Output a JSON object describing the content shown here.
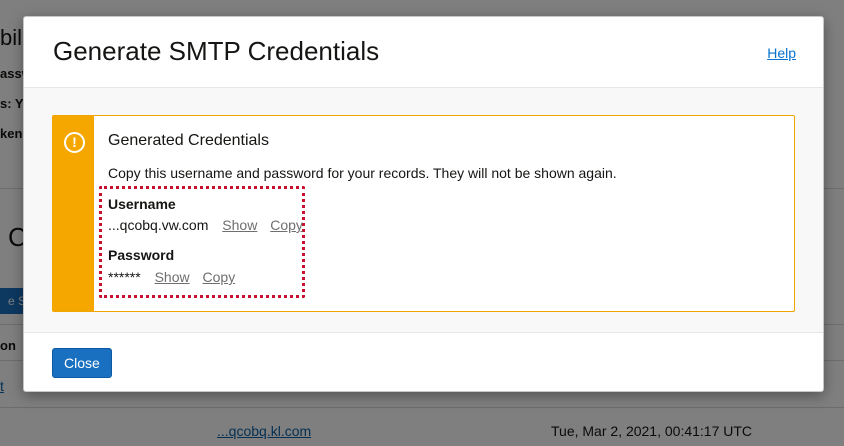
{
  "background": {
    "title_fragment": "bili",
    "label_1": "assw",
    "label_2": "s: Ye",
    "label_3": "kens",
    "section_heading": "C",
    "button_fragment": "e SM",
    "column_fragment": "on",
    "row_link_fragment": "t",
    "row_link": "...qcobq.kl.com",
    "row_timestamp": "Tue, Mar 2, 2021, 00:41:17 UTC"
  },
  "dialog": {
    "title": "Generate SMTP Credentials",
    "help_label": "Help",
    "alert": {
      "icon": "warning-circle-icon",
      "title": "Generated Credentials",
      "message": "Copy this username and password for your records. They will not be shown again.",
      "username_label": "Username",
      "username_value": "...qcobq.vw.com",
      "password_label": "Password",
      "password_value": "******",
      "show_label": "Show",
      "copy_label": "Copy"
    },
    "close_label": "Close"
  },
  "colors": {
    "accent": "#1a70c0",
    "warning": "#f5a700",
    "highlight_border": "#c8102e",
    "link": "#0572ce"
  }
}
